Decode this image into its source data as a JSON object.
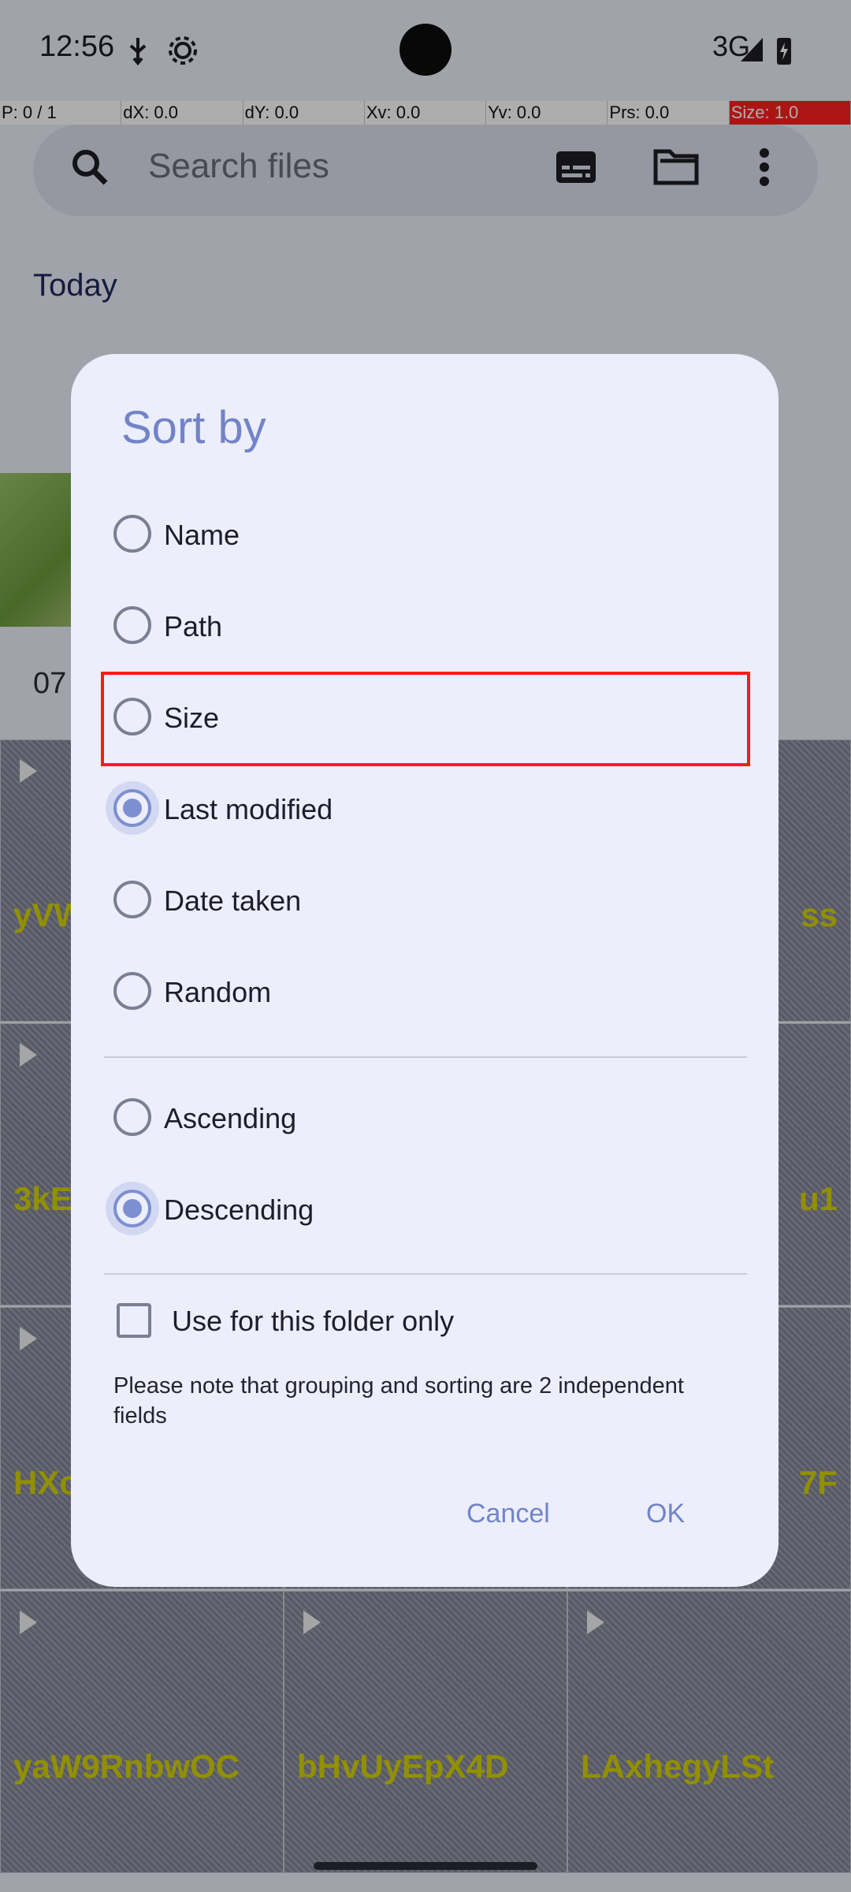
{
  "status": {
    "time": "12:56",
    "network": "3G"
  },
  "debug_bar": [
    "P: 0 / 1",
    "dX: 0.0",
    "dY: 0.0",
    "Xv: 0.0",
    "Yv: 0.0",
    "Prs: 0.0",
    "Size: 1.0"
  ],
  "search": {
    "placeholder": "Search files"
  },
  "background": {
    "section": "Today",
    "date_label": "07",
    "tiles": [
      "yVW",
      "ss",
      "3kE",
      "u1",
      "HXc",
      "7F",
      "yaW9RnbwOC",
      "bHvUyEpX4D",
      "LAxhegyLSt"
    ]
  },
  "dialog": {
    "title": "Sort by",
    "sort_options": [
      "Name",
      "Path",
      "Size",
      "Last modified",
      "Date taken",
      "Random"
    ],
    "selected_sort": "Last modified",
    "order_options": [
      "Ascending",
      "Descending"
    ],
    "selected_order": "Descending",
    "folder_only_label": "Use for this folder only",
    "folder_only_checked": false,
    "note": "Please note that grouping and sorting are 2 independent fields",
    "cancel_label": "Cancel",
    "ok_label": "OK"
  },
  "colors": {
    "accent": "#7d8fd0",
    "highlight": "#ff1a1a"
  }
}
